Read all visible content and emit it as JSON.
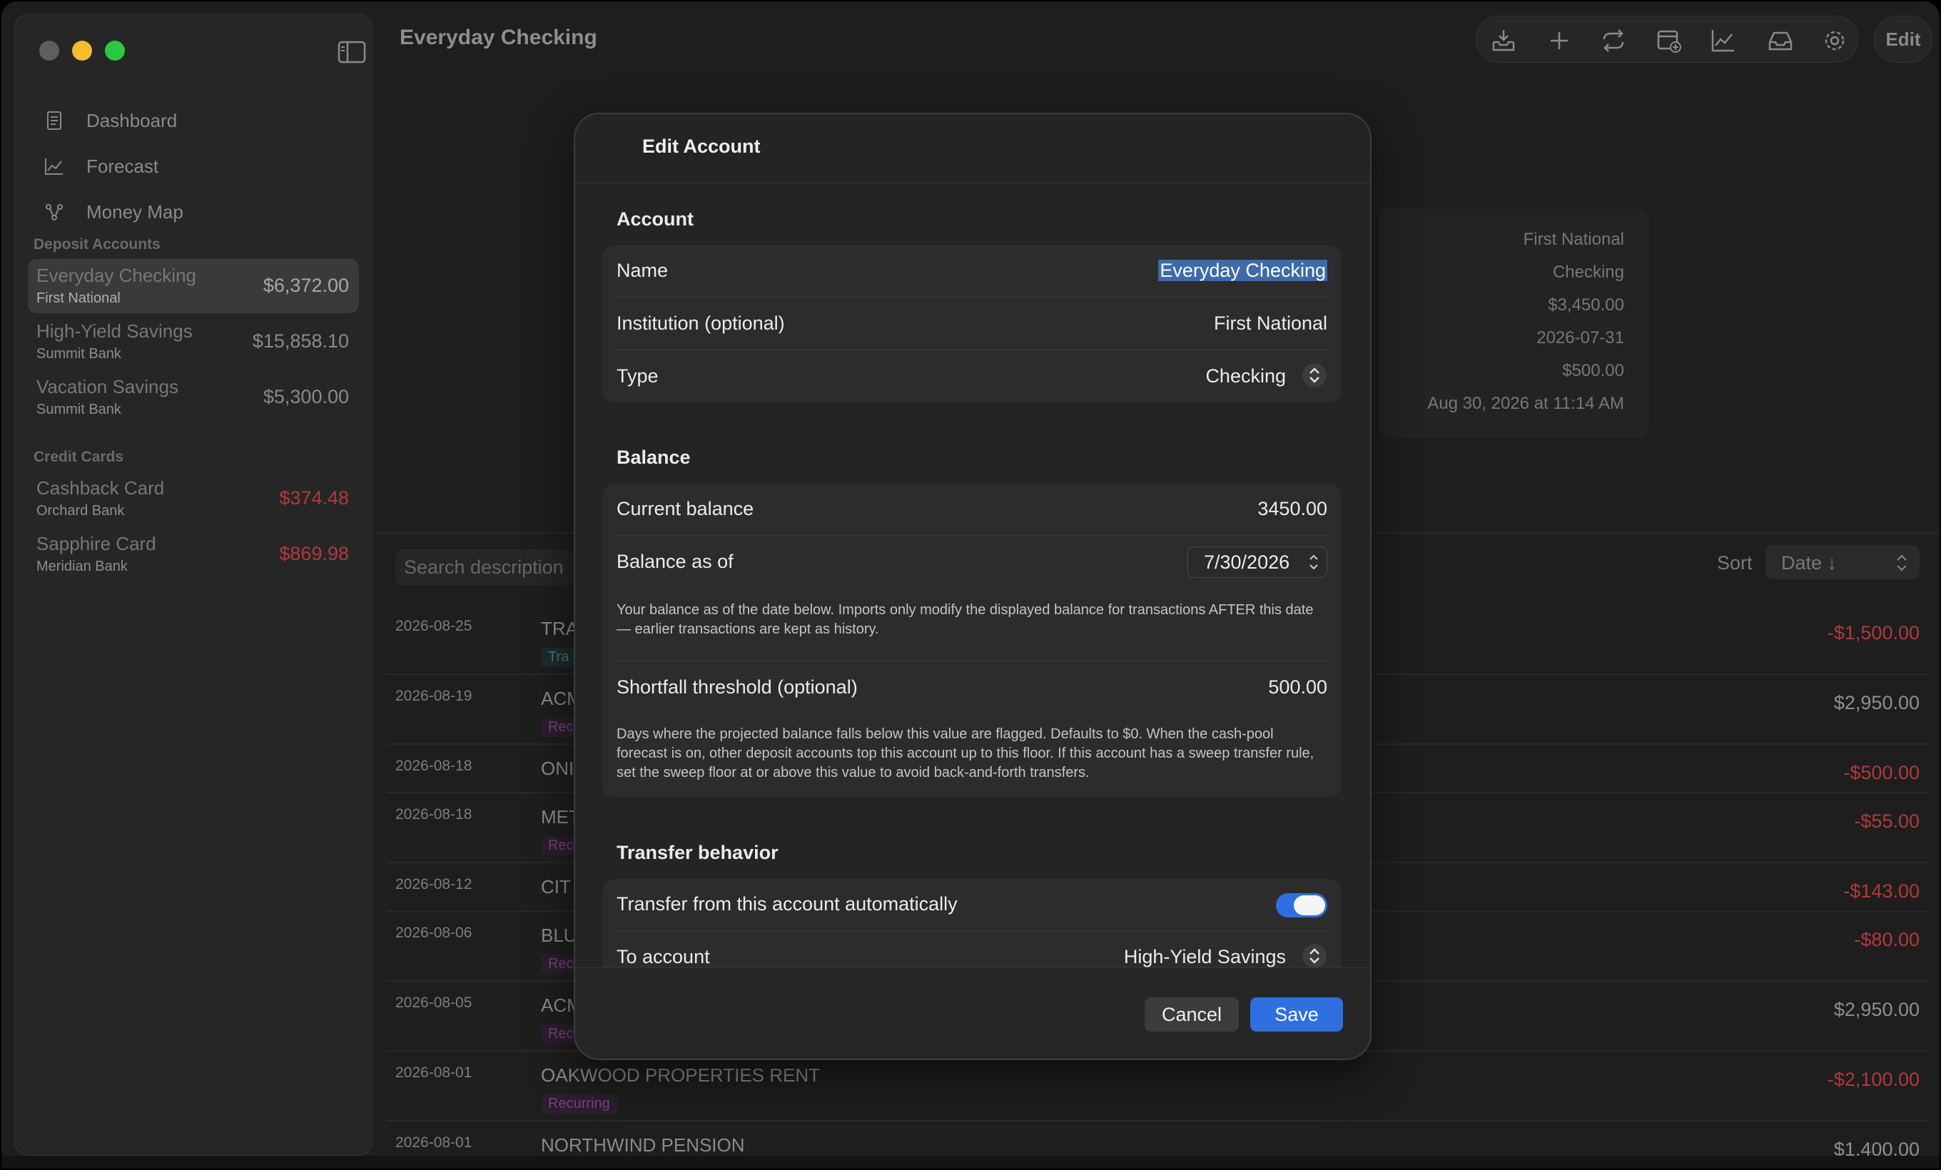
{
  "window": {
    "title": "Everyday Checking",
    "edit_label": "Edit"
  },
  "sidebar": {
    "nav": [
      {
        "label": "Dashboard",
        "icon": "document-icon"
      },
      {
        "label": "Forecast",
        "icon": "line-chart-icon"
      },
      {
        "label": "Money Map",
        "icon": "network-icon"
      }
    ],
    "deposit_label": "Deposit Accounts",
    "deposit_accounts": [
      {
        "name": "Everyday Checking",
        "institution": "First National",
        "balance": "$6,372.00",
        "selected": true
      },
      {
        "name": "High-Yield Savings",
        "institution": "Summit Bank",
        "balance": "$15,858.10"
      },
      {
        "name": "Vacation Savings",
        "institution": "Summit Bank",
        "balance": "$5,300.00"
      }
    ],
    "credit_label": "Credit Cards",
    "credit_cards": [
      {
        "name": "Cashback Card",
        "institution": "Orchard Bank",
        "balance": "$374.48"
      },
      {
        "name": "Sapphire Card",
        "institution": "Meridian Bank",
        "balance": "$869.98"
      }
    ]
  },
  "toolbar": {
    "icons": [
      "inbox-download-icon",
      "plus-icon",
      "transfer-icon",
      "calendar-add-icon",
      "chart-icon",
      "tray-icon",
      "gear-icon"
    ]
  },
  "account_info": [
    "First National",
    "Checking",
    "$3,450.00",
    "2026-07-31",
    "$500.00",
    "Aug 30, 2026 at 11:14 AM"
  ],
  "filters": {
    "search_placeholder": "Search description",
    "sort_label": "Sort",
    "sort_value": "Date ↓"
  },
  "transactions": [
    {
      "date": "2026-08-25",
      "name": "TRA",
      "tag": "Tra",
      "tag_type": "tr",
      "amount": "-$1,500.00",
      "neg": true
    },
    {
      "date": "2026-08-19",
      "name": "ACM",
      "tag": "Rec",
      "tag_type": "rec",
      "amount": "$2,950.00",
      "neg": false
    },
    {
      "date": "2026-08-18",
      "name": "ONI",
      "tag": "",
      "tag_type": "",
      "amount": "-$500.00",
      "neg": true
    },
    {
      "date": "2026-08-18",
      "name": "MET",
      "tag": "Rec",
      "tag_type": "rec",
      "amount": "-$55.00",
      "neg": true
    },
    {
      "date": "2026-08-12",
      "name": "CIT",
      "tag": "",
      "tag_type": "",
      "amount": "-$143.00",
      "neg": true
    },
    {
      "date": "2026-08-06",
      "name": "BLU",
      "tag": "Rec",
      "tag_type": "rec",
      "amount": "-$80.00",
      "neg": true
    },
    {
      "date": "2026-08-05",
      "name": "ACM",
      "tag": "Rec",
      "tag_type": "rec",
      "amount": "$2,950.00",
      "neg": false
    },
    {
      "date": "2026-08-01",
      "name": "OAKWOOD PROPERTIES RENT",
      "tag": "Recurring",
      "tag_type": "rec",
      "amount": "-$2,100.00",
      "neg": true
    },
    {
      "date": "2026-08-01",
      "name": "NORTHWIND PENSION",
      "tag": "",
      "tag_type": "",
      "amount": "$1,400.00",
      "neg": false
    }
  ],
  "modal": {
    "title": "Edit Account",
    "account_section": "Account",
    "name_label": "Name",
    "name_value": "Everyday Checking",
    "institution_label": "Institution (optional)",
    "institution_value": "First National",
    "type_label": "Type",
    "type_value": "Checking",
    "balance_section": "Balance",
    "current_balance_label": "Current balance",
    "current_balance_value": "3450.00",
    "balance_as_of_label": "Balance as of",
    "balance_as_of_value": "7/30/2026",
    "balance_note": "Your balance as of the date below. Imports only modify the displayed balance for transactions AFTER this date — earlier transactions are kept as history.",
    "shortfall_label": "Shortfall threshold (optional)",
    "shortfall_value": "500.00",
    "shortfall_note": "Days where the projected balance falls below this value are flagged. Defaults to $0. When the cash-pool forecast is on, other deposit accounts top this account up to this floor. If this account has a sweep transfer rule, set the sweep floor at or above this value to avoid back-and-forth transfers.",
    "transfer_section": "Transfer behavior",
    "auto_transfer_label": "Transfer from this account automatically",
    "auto_transfer_on": true,
    "to_account_label": "To account",
    "to_account_value": "High-Yield Savings",
    "cancel_label": "Cancel",
    "save_label": "Save"
  }
}
